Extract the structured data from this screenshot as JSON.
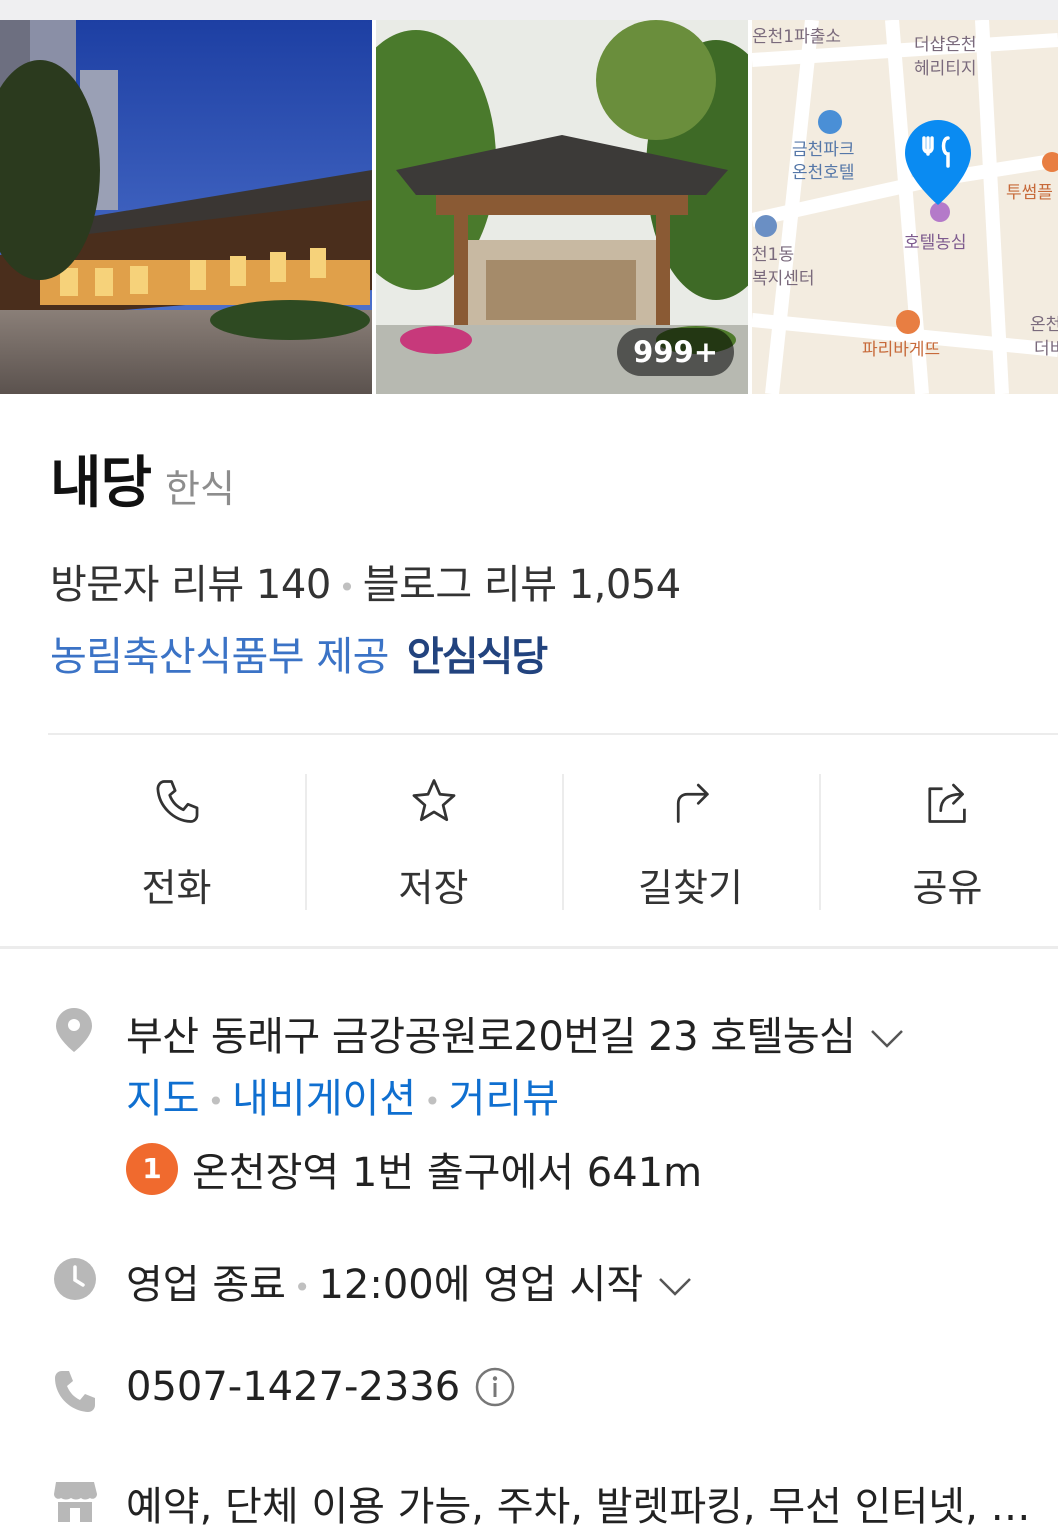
{
  "gallery": {
    "photo_count": "999+",
    "map_labels": {
      "police": "온천1파출소",
      "heritage": "더샵온천\n헤리티지",
      "hotel_park": "금천파크\n온천호텔",
      "center": "천1동\n복지센터",
      "hotel_nongshim": "호텔농심",
      "tousome": "투썸플",
      "paris": "파리바게뜨",
      "right_edge": "온천\n더비"
    }
  },
  "place": {
    "name": "내당",
    "category": "한식"
  },
  "reviews": {
    "visitor_label": "방문자 리뷰 140",
    "blog_label": "블로그 리뷰 1,054"
  },
  "certification": {
    "provider": "농림축산식품부 제공",
    "badge": "안심식당"
  },
  "actions": [
    {
      "label": "전화",
      "icon": "phone-icon"
    },
    {
      "label": "저장",
      "icon": "star-icon"
    },
    {
      "label": "길찾기",
      "icon": "directions-icon"
    },
    {
      "label": "공유",
      "icon": "share-icon"
    }
  ],
  "address": {
    "text": "부산 동래구 금강공원로20번길 23 호텔농심",
    "links": [
      "지도",
      "내비게이션",
      "거리뷰"
    ],
    "station_line": "1",
    "station_text": "온천장역 1번 출구에서 641m"
  },
  "hours": {
    "status": "영업 종료",
    "next": "12:00에 영업 시작"
  },
  "phone": {
    "number": "0507-1427-2336"
  },
  "amenities": {
    "text": "예약, 단체 이용 가능, 주차, 발렛파킹, 무선 인터넷, 남/녀 화장실 구분"
  },
  "colors": {
    "link_blue": "#0f6fd0",
    "cert_blue": "#3b73c6",
    "subway_line1": "#f06a2e",
    "map_pin": "#0a8bf2"
  }
}
